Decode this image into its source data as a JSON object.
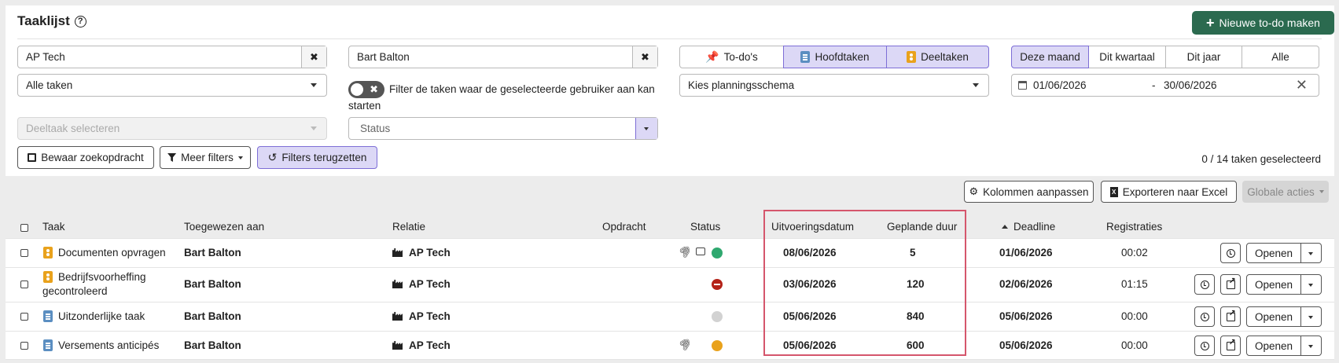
{
  "header": {
    "title": "Taaklijst",
    "help_glyph": "?",
    "new_button_label": "Nieuwe to-do maken"
  },
  "filters": {
    "relation_value": "AP Tech",
    "user_value": "Bart Balton",
    "task_type_value": "Alle taken",
    "subtask_placeholder": "Deeltaak selecteren",
    "toggle_text": "Filter de taken waar de geselecteerde gebruiker aan kan starten",
    "status_placeholder": "Status",
    "schedule_placeholder": "Kies planningsschema",
    "type_segments": [
      {
        "label": "To-do's",
        "icon": "pin-icon",
        "active": false
      },
      {
        "label": "Hoofdtaken",
        "icon": "clipboard-icon",
        "active": true
      },
      {
        "label": "Deeltaken",
        "icon": "badge-icon",
        "active": true
      }
    ],
    "period_segments": [
      {
        "label": "Deze maand",
        "active": true
      },
      {
        "label": "Dit kwartaal",
        "active": false
      },
      {
        "label": "Dit jaar",
        "active": false
      },
      {
        "label": "Alle",
        "active": false
      }
    ],
    "date_from": "01/06/2026",
    "date_separator": "-",
    "date_to": "30/06/2026",
    "save_search_label": "Bewaar zoekopdracht",
    "more_filters_label": "Meer filters",
    "reset_filters_label": "Filters terugzetten",
    "selected_count": "0 / 14 taken geselecteerd"
  },
  "toolbar": {
    "columns_label": "Kolommen aanpassen",
    "export_label": "Exporteren naar Excel",
    "global_actions_label": "Globale acties"
  },
  "table": {
    "columns": {
      "task": "Taak",
      "assigned": "Toegewezen aan",
      "relation": "Relatie",
      "assignment": "Opdracht",
      "status": "Status",
      "execution_date": "Uitvoeringsdatum",
      "planned_duration": "Geplande duur",
      "deadline": "Deadline",
      "registrations": "Registraties"
    },
    "open_label": "Openen",
    "rows": [
      {
        "task": "Documenten opvragen",
        "task_type": "subtask",
        "assigned": "Bart Balton",
        "relation": "AP Tech",
        "status": "green",
        "attachment": true,
        "comment": true,
        "execution_date": "08/06/2026",
        "planned_duration": "5",
        "deadline": "01/06/2026",
        "registrations": "00:02"
      },
      {
        "task": "Bedrijfsvoorheffing gecontroleerd",
        "task_type": "subtask",
        "assigned": "Bart Balton",
        "relation": "AP Tech",
        "status": "blocked",
        "attachment": false,
        "comment": false,
        "execution_date": "03/06/2026",
        "planned_duration": "120",
        "deadline": "02/06/2026",
        "registrations": "01:15"
      },
      {
        "task": "Uitzonderlijke taak",
        "task_type": "main",
        "assigned": "Bart Balton",
        "relation": "AP Tech",
        "status": "grey",
        "attachment": false,
        "comment": false,
        "execution_date": "05/06/2026",
        "planned_duration": "840",
        "deadline": "05/06/2026",
        "registrations": "00:00"
      },
      {
        "task": "Versements anticipés",
        "task_type": "main",
        "assigned": "Bart Balton",
        "relation": "AP Tech",
        "status": "orange",
        "attachment": true,
        "comment": false,
        "execution_date": "05/06/2026",
        "planned_duration": "600",
        "deadline": "05/06/2026",
        "registrations": "00:00"
      }
    ]
  },
  "colors": {
    "primary_green": "#2b6a4f",
    "active_segment": "#dcd8f6",
    "highlight_border": "#d5566c",
    "status_green": "#2fa86f",
    "status_red": "#b42318",
    "status_grey": "#d2d2d2",
    "status_orange": "#e9a21c"
  }
}
